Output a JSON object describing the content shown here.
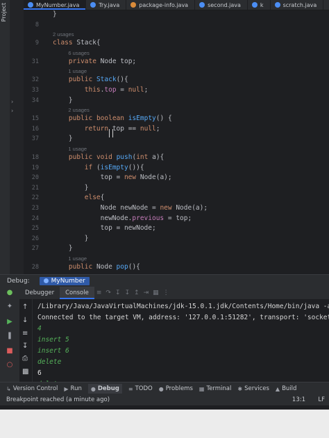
{
  "tabs": [
    {
      "label": "MyNumber.java",
      "active": true
    },
    {
      "label": "Try.java"
    },
    {
      "label": "package-info.java"
    },
    {
      "label": "second.java"
    },
    {
      "label": "k"
    },
    {
      "label": "scratch.java"
    }
  ],
  "project_label": "Project",
  "code_lines": [
    {
      "n": "",
      "text": "}"
    },
    {
      "n": "8",
      "text": ""
    },
    {
      "n": "",
      "text": "2 usages",
      "hint": true
    },
    {
      "n": "9",
      "text": "class Stack{"
    },
    {
      "n": "",
      "text": "6 usages",
      "hint": true
    },
    {
      "n": "31",
      "text": "    private Node top;"
    },
    {
      "n": "",
      "text": "1 usage",
      "hint": true
    },
    {
      "n": "32",
      "text": "    public Stack(){"
    },
    {
      "n": "33",
      "text": "        this.top = null;"
    },
    {
      "n": "34",
      "text": "    }"
    },
    {
      "n": "",
      "text": "2 usages",
      "hint": true
    },
    {
      "n": "15",
      "text": "    public boolean isEmpty() {"
    },
    {
      "n": "16",
      "text": "        return top == null;"
    },
    {
      "n": "37",
      "text": "    }"
    },
    {
      "n": "",
      "text": "1 usage",
      "hint": true
    },
    {
      "n": "18",
      "text": "    public void push(int a){"
    },
    {
      "n": "19",
      "text": "        if (isEmpty()){"
    },
    {
      "n": "20",
      "text": "            top = new Node(a);"
    },
    {
      "n": "21",
      "text": "        }"
    },
    {
      "n": "22",
      "text": "        else{"
    },
    {
      "n": "23",
      "text": "            Node newNode = new Node(a);"
    },
    {
      "n": "24",
      "text": "            newNode.previous = top;"
    },
    {
      "n": "25",
      "text": "            top = newNode;"
    },
    {
      "n": "26",
      "text": "        }"
    },
    {
      "n": "27",
      "text": "    }"
    },
    {
      "n": "",
      "text": "1 usage",
      "hint": true
    },
    {
      "n": "28",
      "text": "    public Node pop(){"
    }
  ],
  "debug": {
    "label": "Debug:",
    "session": "MyNumber",
    "subtabs": [
      "Debugger",
      "Console"
    ],
    "active_subtab": "Console"
  },
  "console_lines": [
    {
      "text": "/Library/Java/JavaVirtualMachines/jdk-15.0.1.jdk/Contents/Home/bin/java -agen",
      "kind": "cmd"
    },
    {
      "text": "Connected to the target VM, address: '127.0.0.1:51282', transport: 'socket'",
      "kind": "cmd"
    },
    {
      "text": "4",
      "kind": "out"
    },
    {
      "text": "insert 5",
      "kind": "out"
    },
    {
      "text": "insert 6",
      "kind": "out"
    },
    {
      "text": "delete",
      "kind": "out"
    },
    {
      "text": "6",
      "kind": "plain"
    },
    {
      "text": "delete",
      "kind": "out"
    }
  ],
  "bottom_tools": [
    {
      "label": "Version Control",
      "icon": "branch-icon"
    },
    {
      "label": "Run",
      "icon": "play-icon"
    },
    {
      "label": "Debug",
      "icon": "bug-icon",
      "active": true
    },
    {
      "label": "TODO",
      "icon": "list-icon"
    },
    {
      "label": "Problems",
      "icon": "problems-icon"
    },
    {
      "label": "Terminal",
      "icon": "terminal-icon"
    },
    {
      "label": "Services",
      "icon": "services-icon"
    },
    {
      "label": "Build",
      "icon": "hammer-icon"
    }
  ],
  "status": {
    "message": "Breakpoint reached (a minute ago)",
    "position": "13:1",
    "line_ending": "LF"
  },
  "colors": {
    "accent": "#3574f0",
    "console_output": "#56b35b",
    "keyword": "#cf8e6d",
    "method": "#56a8f5",
    "field": "#c77dbb"
  }
}
